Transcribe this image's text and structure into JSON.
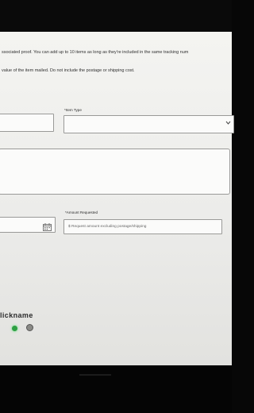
{
  "form": {
    "instructions_line1": "ssociated proof. You can add up to 10 items as long as they're included in the same tracking num",
    "instructions_line2": "value of the item mailed. Do not include the postage or shipping cost.",
    "item_type_label": "*Item Type",
    "amount_label": "*Amount Requested",
    "amount_placeholder": "$  Request amount excluding postage/shipping",
    "nickname_label": "lickname"
  },
  "icons": {
    "select_chevron": "chevron-down-icon",
    "date_picker": "calendar-icon"
  },
  "colors": {
    "status_green": "#2ea043"
  }
}
